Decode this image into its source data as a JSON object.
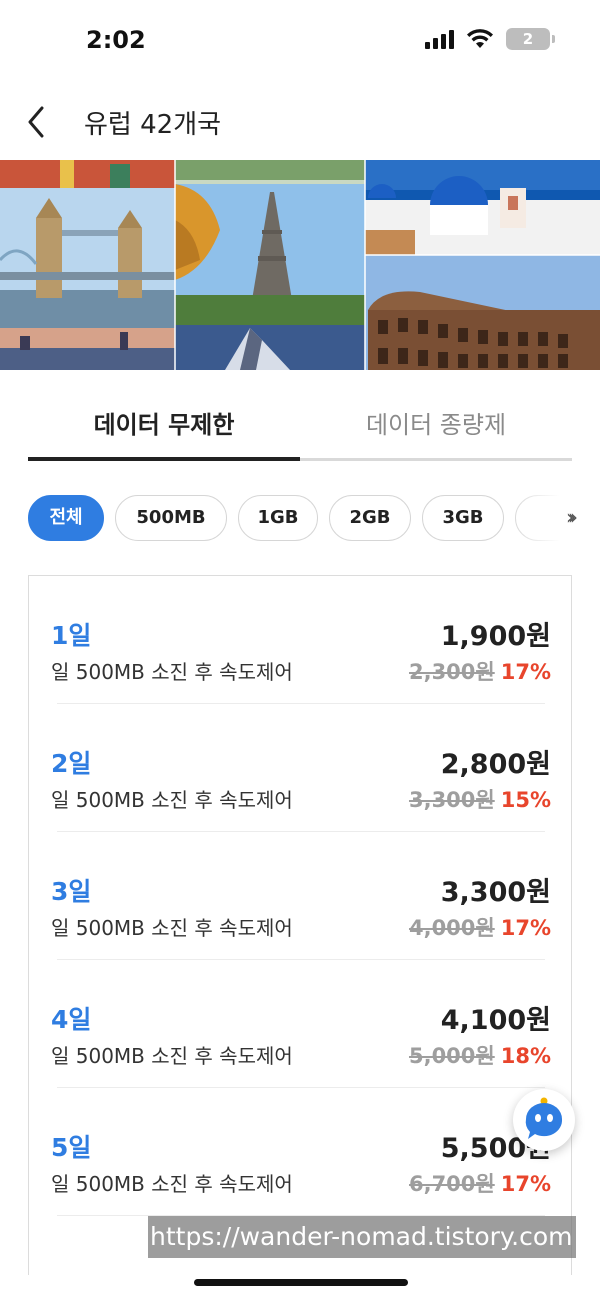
{
  "status_bar": {
    "time": "2:02",
    "battery_level": "2"
  },
  "header": {
    "back_icon": "chevron-left-icon",
    "title": "유럽 42개국"
  },
  "tabs": [
    {
      "label": "데이터 무제한",
      "active": true
    },
    {
      "label": "데이터 종량제",
      "active": false
    }
  ],
  "filters": {
    "chips": [
      {
        "label": "전체",
        "selected": true
      },
      {
        "label": "500MB",
        "selected": false
      },
      {
        "label": "1GB",
        "selected": false
      },
      {
        "label": "2GB",
        "selected": false
      },
      {
        "label": "3GB",
        "selected": false
      }
    ],
    "more_icon": "double-chevron-right-icon"
  },
  "plans": [
    {
      "day": "1일",
      "desc": "일 500MB 소진 후 속도제어",
      "price": "1,900원",
      "original": "2,300원",
      "discount": "17%"
    },
    {
      "day": "2일",
      "desc": "일 500MB 소진 후 속도제어",
      "price": "2,800원",
      "original": "3,300원",
      "discount": "15%"
    },
    {
      "day": "3일",
      "desc": "일 500MB 소진 후 속도제어",
      "price": "3,300원",
      "original": "4,000원",
      "discount": "17%"
    },
    {
      "day": "4일",
      "desc": "일 500MB 소진 후 속도제어",
      "price": "4,100원",
      "original": "5,000원",
      "discount": "18%"
    },
    {
      "day": "5일",
      "desc": "일 500MB 소진 후 속도제어",
      "price": "5,500원",
      "original": "6,700원",
      "discount": "17%"
    }
  ],
  "chatbot_icon": "chatbot-icon",
  "watermark": "https://wander-nomad.tistory.com",
  "colors": {
    "accent": "#2f7de1",
    "discount": "#e8452c",
    "strikethrough": "#9e9e9e"
  }
}
